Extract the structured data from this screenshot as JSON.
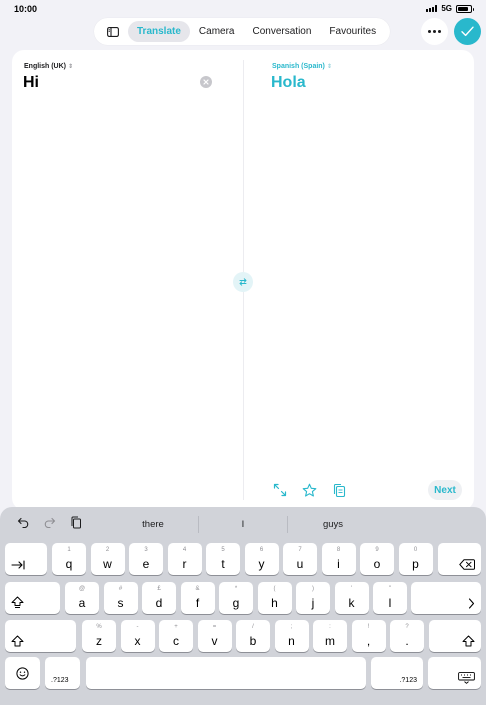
{
  "status": {
    "time": "10:00",
    "network": "5G",
    "battery_level": 0.85
  },
  "tabs": [
    {
      "label": "Translate",
      "active": true
    },
    {
      "label": "Camera",
      "active": false
    },
    {
      "label": "Conversation",
      "active": false
    },
    {
      "label": "Favourites",
      "active": false
    }
  ],
  "translation": {
    "source_language": "English (UK)",
    "target_language": "Spanish (Spain)",
    "source_text": "Hi",
    "target_text": "Hola",
    "next_label": "Next"
  },
  "suggestions": [
    "there",
    "I",
    "guys"
  ],
  "keyboard": {
    "row1": [
      {
        "hint": "1",
        "main": "q"
      },
      {
        "hint": "2",
        "main": "w"
      },
      {
        "hint": "3",
        "main": "e"
      },
      {
        "hint": "4",
        "main": "r"
      },
      {
        "hint": "5",
        "main": "t"
      },
      {
        "hint": "6",
        "main": "y"
      },
      {
        "hint": "7",
        "main": "u"
      },
      {
        "hint": "8",
        "main": "i"
      },
      {
        "hint": "9",
        "main": "o"
      },
      {
        "hint": "0",
        "main": "p"
      }
    ],
    "row2": [
      {
        "hint": "@",
        "main": "a"
      },
      {
        "hint": "#",
        "main": "s"
      },
      {
        "hint": "£",
        "main": "d"
      },
      {
        "hint": "&",
        "main": "f"
      },
      {
        "hint": "*",
        "main": "g"
      },
      {
        "hint": "(",
        "main": "h"
      },
      {
        "hint": ")",
        "main": "j"
      },
      {
        "hint": "'",
        "main": "k"
      },
      {
        "hint": "\"",
        "main": "l"
      }
    ],
    "row3": [
      {
        "hint": "%",
        "main": "z"
      },
      {
        "hint": "-",
        "main": "x"
      },
      {
        "hint": "+",
        "main": "c"
      },
      {
        "hint": "=",
        "main": "v"
      },
      {
        "hint": "/",
        "main": "b"
      },
      {
        "hint": ";",
        "main": "n"
      },
      {
        "hint": ":",
        "main": "m"
      },
      {
        "hint": "!",
        "main": ","
      },
      {
        "hint": "?",
        "main": "."
      }
    ],
    "numbers_label": ".?123"
  },
  "colors": {
    "accent": "#29b8cc",
    "background": "#f2f2f7",
    "keyboard": "#d1d3d9"
  }
}
